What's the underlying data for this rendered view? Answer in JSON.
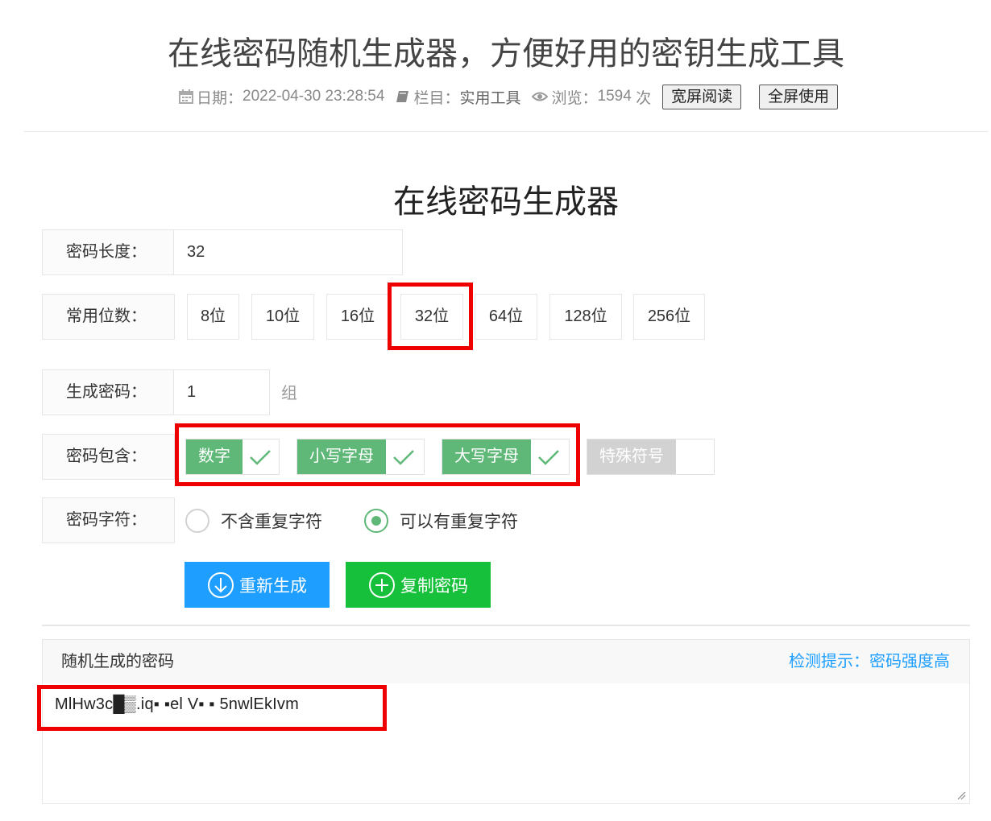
{
  "article": {
    "title": "在线密码随机生成器，方便好用的密钥生成工具",
    "date_label": "日期：",
    "date": "2022-04-30 23:28:54",
    "column_label": "栏目：",
    "column": "实用工具",
    "views_label": "浏览：",
    "views": "1594",
    "views_unit": "次",
    "wide_btn": "宽屏阅读",
    "full_btn": "全屏使用"
  },
  "tool": {
    "title": "在线密码生成器",
    "length_label": "密码长度：",
    "length_value": "32",
    "common_label": "常用位数：",
    "lengths": [
      "8位",
      "10位",
      "16位",
      "32位",
      "64位",
      "128位",
      "256位"
    ],
    "count_label": "生成密码：",
    "count_value": "1",
    "count_unit": "组",
    "include_label": "密码包含：",
    "includes": [
      {
        "label": "数字",
        "checked": true
      },
      {
        "label": "小写字母",
        "checked": true
      },
      {
        "label": "大写字母",
        "checked": true
      },
      {
        "label": "特殊符号",
        "checked": false
      }
    ],
    "chars_label": "密码字符：",
    "radio_no_repeat": "不含重复字符",
    "radio_repeat": "可以有重复字符",
    "regen_btn": "重新生成",
    "copy_btn": "复制密码",
    "result_title": "随机生成的密码",
    "result_hint": "检测提示：密码强度高",
    "password": "MlHw3c█▒.iq▪ ▪el V▪ ▪ 5nwlEkIvm"
  },
  "colors": {
    "accent_green": "#5fb878",
    "btn_blue": "#1e9fff",
    "btn_green": "#16c03a",
    "highlight_red": "#ee0000"
  }
}
